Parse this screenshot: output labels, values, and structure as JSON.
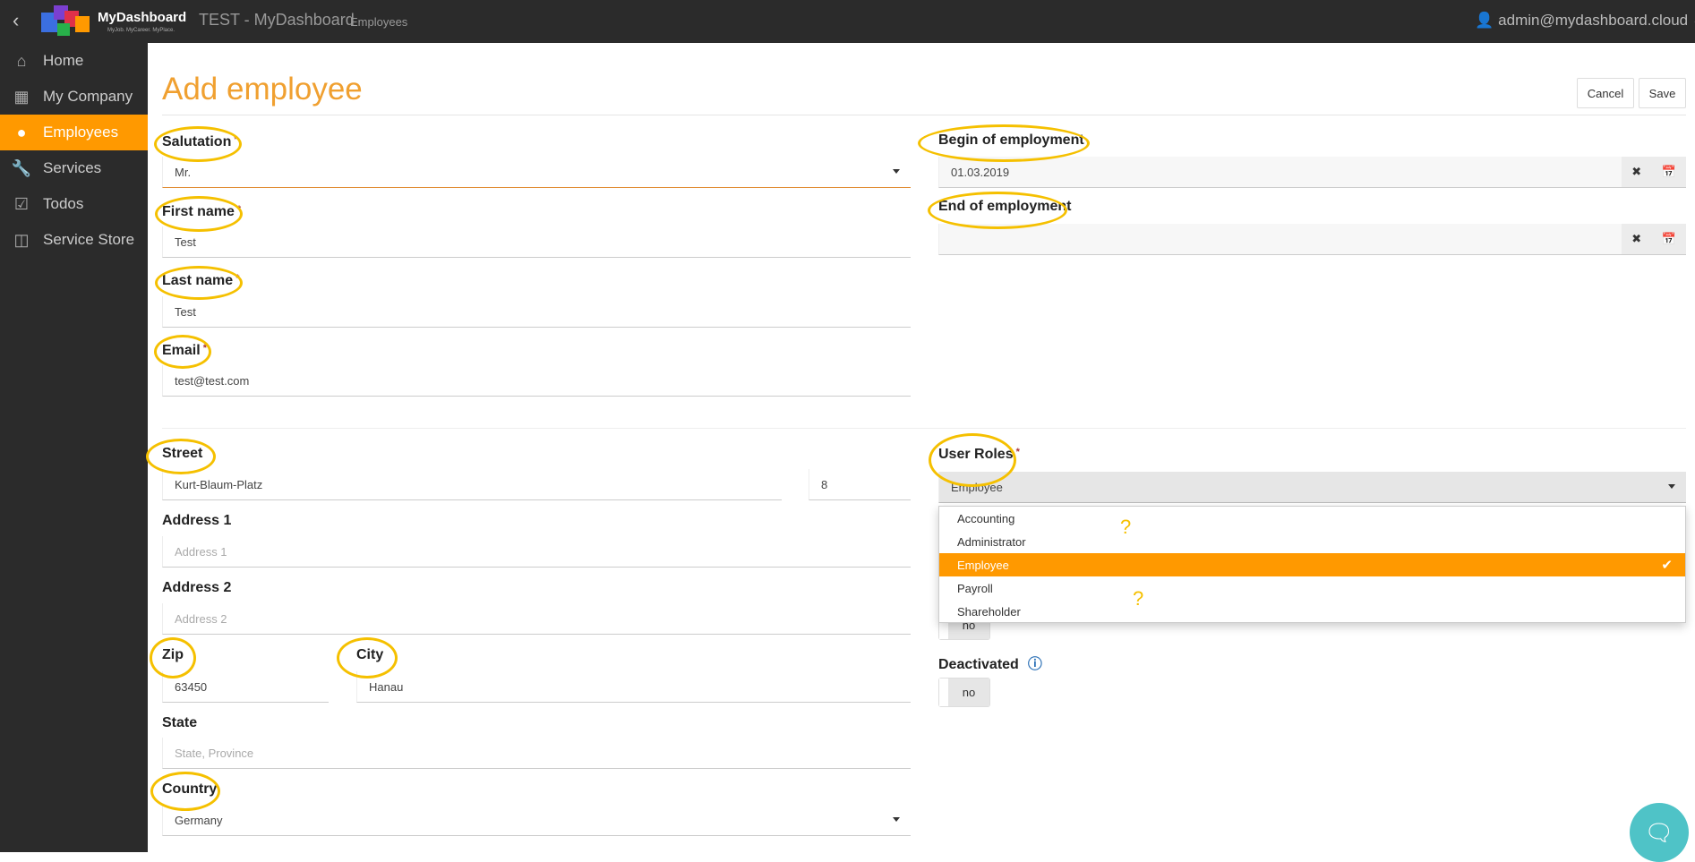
{
  "topbar": {
    "logo_text": "MyDashboard",
    "logo_tagline": "MyJob. MyCareer. MyPlace.",
    "app_title": "TEST - MyDashboard",
    "breadcrumb": "Employees",
    "user": "admin@mydashboard.cloud"
  },
  "sidebar": {
    "items": [
      {
        "label": "Home",
        "icon": "home-icon"
      },
      {
        "label": "My Company",
        "icon": "building-icon"
      },
      {
        "label": "Employees",
        "icon": "user-icon",
        "active": true
      },
      {
        "label": "Services",
        "icon": "wrench-icon"
      },
      {
        "label": "Todos",
        "icon": "checkbox-icon"
      },
      {
        "label": "Service Store",
        "icon": "basket-icon"
      }
    ]
  },
  "page": {
    "title": "Add employee",
    "cancel": "Cancel",
    "save": "Save"
  },
  "form": {
    "salutation": {
      "label": "Salutation",
      "value": "Mr."
    },
    "first_name": {
      "label": "First name",
      "value": "Test"
    },
    "last_name": {
      "label": "Last name",
      "value": "Test"
    },
    "email": {
      "label": "Email",
      "value": "test@test.com"
    },
    "required_mark": "*",
    "street": {
      "label": "Street",
      "value": "Kurt-Blaum-Platz",
      "number": "8"
    },
    "address1": {
      "label": "Address 1",
      "placeholder": "Address 1"
    },
    "address2": {
      "label": "Address 2",
      "placeholder": "Address 2"
    },
    "zip": {
      "label": "Zip",
      "value": "63450"
    },
    "city": {
      "label": "City",
      "value": "Hanau"
    },
    "state": {
      "label": "State",
      "placeholder": "State, Province"
    },
    "country": {
      "label": "Country",
      "value": "Germany"
    },
    "begin": {
      "label": "Begin of employment",
      "value": "01.03.2019"
    },
    "end": {
      "label": "End of employment",
      "value": ""
    },
    "user_roles": {
      "label": "User Roles",
      "value": "Employee",
      "options": [
        "Accounting",
        "Administrator",
        "Employee",
        "Payroll",
        "Shareholder"
      ],
      "selected": "Employee"
    },
    "hidden_toggle": {
      "value": "no"
    },
    "deactivated": {
      "label": "Deactivated",
      "value": "no"
    }
  },
  "annotations": {
    "question_mark": "?"
  },
  "colors": {
    "accent": "#ff9900",
    "annotation": "#f5c000",
    "dark": "#2b2b2b",
    "chat": "#4fc3c7"
  }
}
